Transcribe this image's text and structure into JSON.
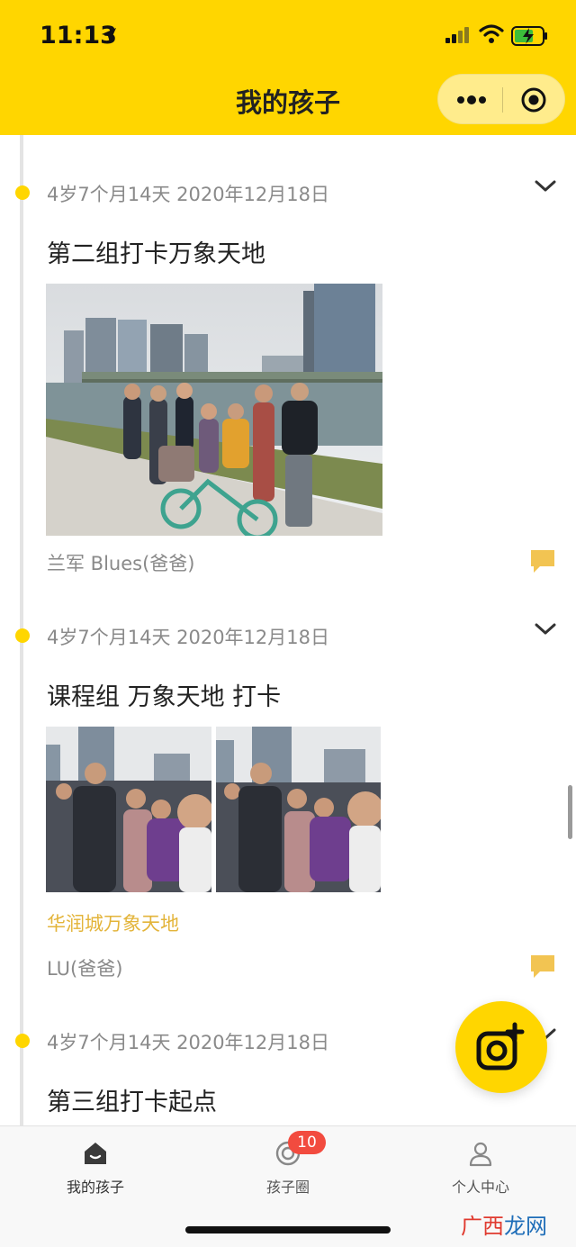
{
  "status_bar": {
    "time": "11:13"
  },
  "header": {
    "title": "我的孩子"
  },
  "posts": [
    {
      "meta": "4岁7个月14天 2020年12月18日",
      "title": "第二组打卡万象天地",
      "author": "兰军 Blues(爸爸)"
    },
    {
      "meta": "4岁7个月14天 2020年12月18日",
      "title": "课程组 万象天地 打卡",
      "location": "华润城万象天地",
      "author": "LU(爸爸)"
    },
    {
      "meta": "4岁7个月14天 2020年12月18日",
      "title": "第三组打卡起点"
    }
  ],
  "tabs": [
    {
      "label": "我的孩子",
      "icon": "home-icon"
    },
    {
      "label": "孩子圈",
      "icon": "circle-icon",
      "badge": "10"
    },
    {
      "label": "个人中心",
      "icon": "person-icon"
    }
  ],
  "colors": {
    "accent": "#FFD600",
    "location": "#E3B43A",
    "badge": "#F24B3F"
  },
  "watermark": {
    "text": "广西龙网"
  }
}
